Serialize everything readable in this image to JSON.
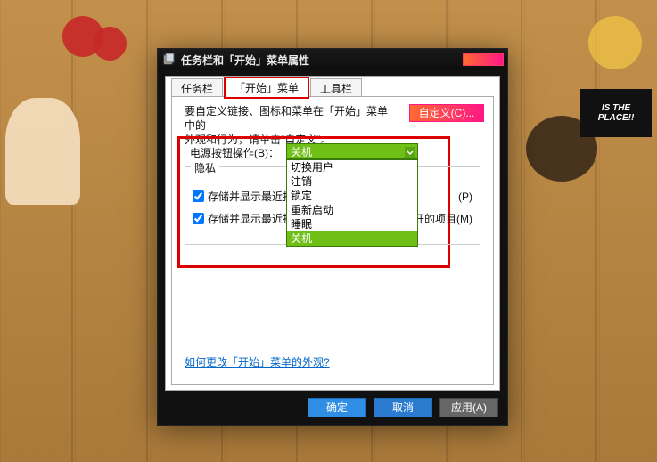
{
  "window": {
    "title": "任务栏和「开始」菜单属性"
  },
  "tabs": {
    "taskbar": "任务栏",
    "start_menu": "「开始」菜单",
    "toolbars": "工具栏"
  },
  "panel": {
    "description_line1": "要自定义链接、图标和菜单在「开始」菜单中的",
    "description_line2": "外观和行为，请单击\"自定义\"。",
    "customize_button": "自定义(C)...",
    "power_label": "电源按钮操作(B)：",
    "power_value": "关机",
    "power_options": [
      "切换用户",
      "注销",
      "锁定",
      "重新启动",
      "睡眠",
      "关机"
    ],
    "privacy_legend": "隐私",
    "chk_programs_label": "存储并显示最近打",
    "chk_programs_tail": "(P)",
    "chk_items_label": "存储并显示最近打",
    "chk_items_tail": "开的项目(M)",
    "link": "如何更改「开始」菜单的外观?"
  },
  "buttons": {
    "ok": "确定",
    "cancel": "取消",
    "apply": "应用(A)"
  }
}
